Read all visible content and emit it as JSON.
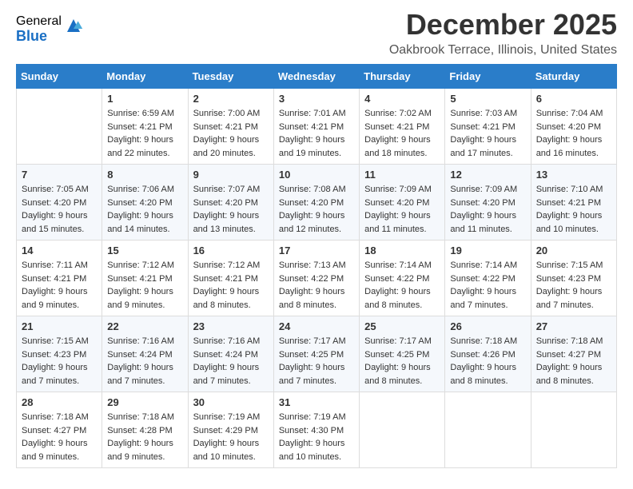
{
  "logo": {
    "general": "General",
    "blue": "Blue"
  },
  "title": "December 2025",
  "subtitle": "Oakbrook Terrace, Illinois, United States",
  "headers": [
    "Sunday",
    "Monday",
    "Tuesday",
    "Wednesday",
    "Thursday",
    "Friday",
    "Saturday"
  ],
  "weeks": [
    [
      {
        "day": "",
        "sunrise": "",
        "sunset": "",
        "daylight": ""
      },
      {
        "day": "1",
        "sunrise": "Sunrise: 6:59 AM",
        "sunset": "Sunset: 4:21 PM",
        "daylight": "Daylight: 9 hours and 22 minutes."
      },
      {
        "day": "2",
        "sunrise": "Sunrise: 7:00 AM",
        "sunset": "Sunset: 4:21 PM",
        "daylight": "Daylight: 9 hours and 20 minutes."
      },
      {
        "day": "3",
        "sunrise": "Sunrise: 7:01 AM",
        "sunset": "Sunset: 4:21 PM",
        "daylight": "Daylight: 9 hours and 19 minutes."
      },
      {
        "day": "4",
        "sunrise": "Sunrise: 7:02 AM",
        "sunset": "Sunset: 4:21 PM",
        "daylight": "Daylight: 9 hours and 18 minutes."
      },
      {
        "day": "5",
        "sunrise": "Sunrise: 7:03 AM",
        "sunset": "Sunset: 4:21 PM",
        "daylight": "Daylight: 9 hours and 17 minutes."
      },
      {
        "day": "6",
        "sunrise": "Sunrise: 7:04 AM",
        "sunset": "Sunset: 4:20 PM",
        "daylight": "Daylight: 9 hours and 16 minutes."
      }
    ],
    [
      {
        "day": "7",
        "sunrise": "Sunrise: 7:05 AM",
        "sunset": "Sunset: 4:20 PM",
        "daylight": "Daylight: 9 hours and 15 minutes."
      },
      {
        "day": "8",
        "sunrise": "Sunrise: 7:06 AM",
        "sunset": "Sunset: 4:20 PM",
        "daylight": "Daylight: 9 hours and 14 minutes."
      },
      {
        "day": "9",
        "sunrise": "Sunrise: 7:07 AM",
        "sunset": "Sunset: 4:20 PM",
        "daylight": "Daylight: 9 hours and 13 minutes."
      },
      {
        "day": "10",
        "sunrise": "Sunrise: 7:08 AM",
        "sunset": "Sunset: 4:20 PM",
        "daylight": "Daylight: 9 hours and 12 minutes."
      },
      {
        "day": "11",
        "sunrise": "Sunrise: 7:09 AM",
        "sunset": "Sunset: 4:20 PM",
        "daylight": "Daylight: 9 hours and 11 minutes."
      },
      {
        "day": "12",
        "sunrise": "Sunrise: 7:09 AM",
        "sunset": "Sunset: 4:20 PM",
        "daylight": "Daylight: 9 hours and 11 minutes."
      },
      {
        "day": "13",
        "sunrise": "Sunrise: 7:10 AM",
        "sunset": "Sunset: 4:21 PM",
        "daylight": "Daylight: 9 hours and 10 minutes."
      }
    ],
    [
      {
        "day": "14",
        "sunrise": "Sunrise: 7:11 AM",
        "sunset": "Sunset: 4:21 PM",
        "daylight": "Daylight: 9 hours and 9 minutes."
      },
      {
        "day": "15",
        "sunrise": "Sunrise: 7:12 AM",
        "sunset": "Sunset: 4:21 PM",
        "daylight": "Daylight: 9 hours and 9 minutes."
      },
      {
        "day": "16",
        "sunrise": "Sunrise: 7:12 AM",
        "sunset": "Sunset: 4:21 PM",
        "daylight": "Daylight: 9 hours and 8 minutes."
      },
      {
        "day": "17",
        "sunrise": "Sunrise: 7:13 AM",
        "sunset": "Sunset: 4:22 PM",
        "daylight": "Daylight: 9 hours and 8 minutes."
      },
      {
        "day": "18",
        "sunrise": "Sunrise: 7:14 AM",
        "sunset": "Sunset: 4:22 PM",
        "daylight": "Daylight: 9 hours and 8 minutes."
      },
      {
        "day": "19",
        "sunrise": "Sunrise: 7:14 AM",
        "sunset": "Sunset: 4:22 PM",
        "daylight": "Daylight: 9 hours and 7 minutes."
      },
      {
        "day": "20",
        "sunrise": "Sunrise: 7:15 AM",
        "sunset": "Sunset: 4:23 PM",
        "daylight": "Daylight: 9 hours and 7 minutes."
      }
    ],
    [
      {
        "day": "21",
        "sunrise": "Sunrise: 7:15 AM",
        "sunset": "Sunset: 4:23 PM",
        "daylight": "Daylight: 9 hours and 7 minutes."
      },
      {
        "day": "22",
        "sunrise": "Sunrise: 7:16 AM",
        "sunset": "Sunset: 4:24 PM",
        "daylight": "Daylight: 9 hours and 7 minutes."
      },
      {
        "day": "23",
        "sunrise": "Sunrise: 7:16 AM",
        "sunset": "Sunset: 4:24 PM",
        "daylight": "Daylight: 9 hours and 7 minutes."
      },
      {
        "day": "24",
        "sunrise": "Sunrise: 7:17 AM",
        "sunset": "Sunset: 4:25 PM",
        "daylight": "Daylight: 9 hours and 7 minutes."
      },
      {
        "day": "25",
        "sunrise": "Sunrise: 7:17 AM",
        "sunset": "Sunset: 4:25 PM",
        "daylight": "Daylight: 9 hours and 8 minutes."
      },
      {
        "day": "26",
        "sunrise": "Sunrise: 7:18 AM",
        "sunset": "Sunset: 4:26 PM",
        "daylight": "Daylight: 9 hours and 8 minutes."
      },
      {
        "day": "27",
        "sunrise": "Sunrise: 7:18 AM",
        "sunset": "Sunset: 4:27 PM",
        "daylight": "Daylight: 9 hours and 8 minutes."
      }
    ],
    [
      {
        "day": "28",
        "sunrise": "Sunrise: 7:18 AM",
        "sunset": "Sunset: 4:27 PM",
        "daylight": "Daylight: 9 hours and 9 minutes."
      },
      {
        "day": "29",
        "sunrise": "Sunrise: 7:18 AM",
        "sunset": "Sunset: 4:28 PM",
        "daylight": "Daylight: 9 hours and 9 minutes."
      },
      {
        "day": "30",
        "sunrise": "Sunrise: 7:19 AM",
        "sunset": "Sunset: 4:29 PM",
        "daylight": "Daylight: 9 hours and 10 minutes."
      },
      {
        "day": "31",
        "sunrise": "Sunrise: 7:19 AM",
        "sunset": "Sunset: 4:30 PM",
        "daylight": "Daylight: 9 hours and 10 minutes."
      },
      {
        "day": "",
        "sunrise": "",
        "sunset": "",
        "daylight": ""
      },
      {
        "day": "",
        "sunrise": "",
        "sunset": "",
        "daylight": ""
      },
      {
        "day": "",
        "sunrise": "",
        "sunset": "",
        "daylight": ""
      }
    ]
  ]
}
